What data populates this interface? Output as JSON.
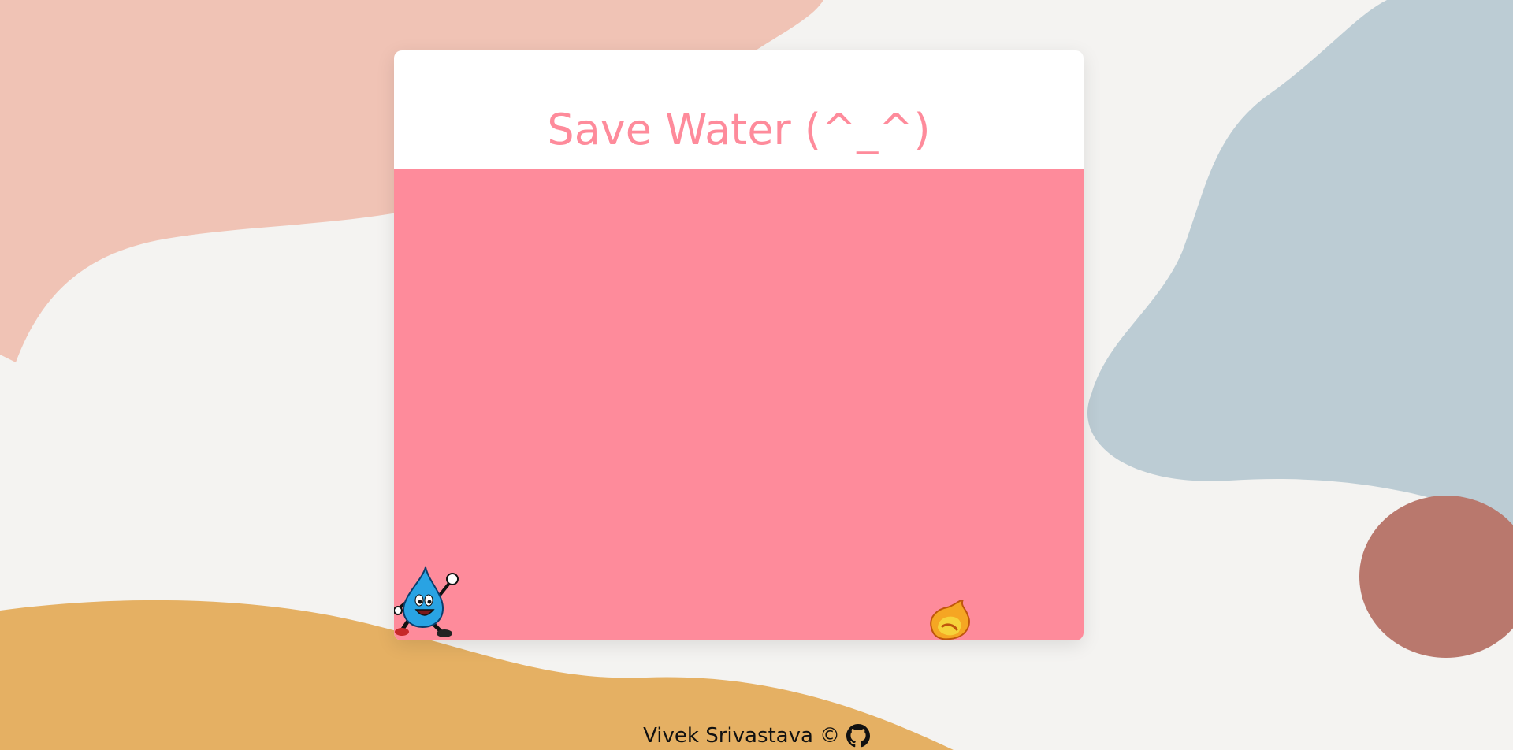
{
  "game": {
    "title": "Save Water (^_^)"
  },
  "footer": {
    "author": "Vivek Srivastava",
    "copyright_symbol": "©",
    "link_icon": "github-icon"
  },
  "icons": {
    "player": "water-drop-character-icon",
    "obstacle": "fireball-icon"
  },
  "colors": {
    "accent": "#fe8b9b",
    "card": "#ffffff",
    "background": "#f4f3f1",
    "blob_pink": "#f0c3b5",
    "blob_blue": "#bcccd4",
    "blob_brown": "#b9786d",
    "blob_orange": "#e5b063"
  }
}
